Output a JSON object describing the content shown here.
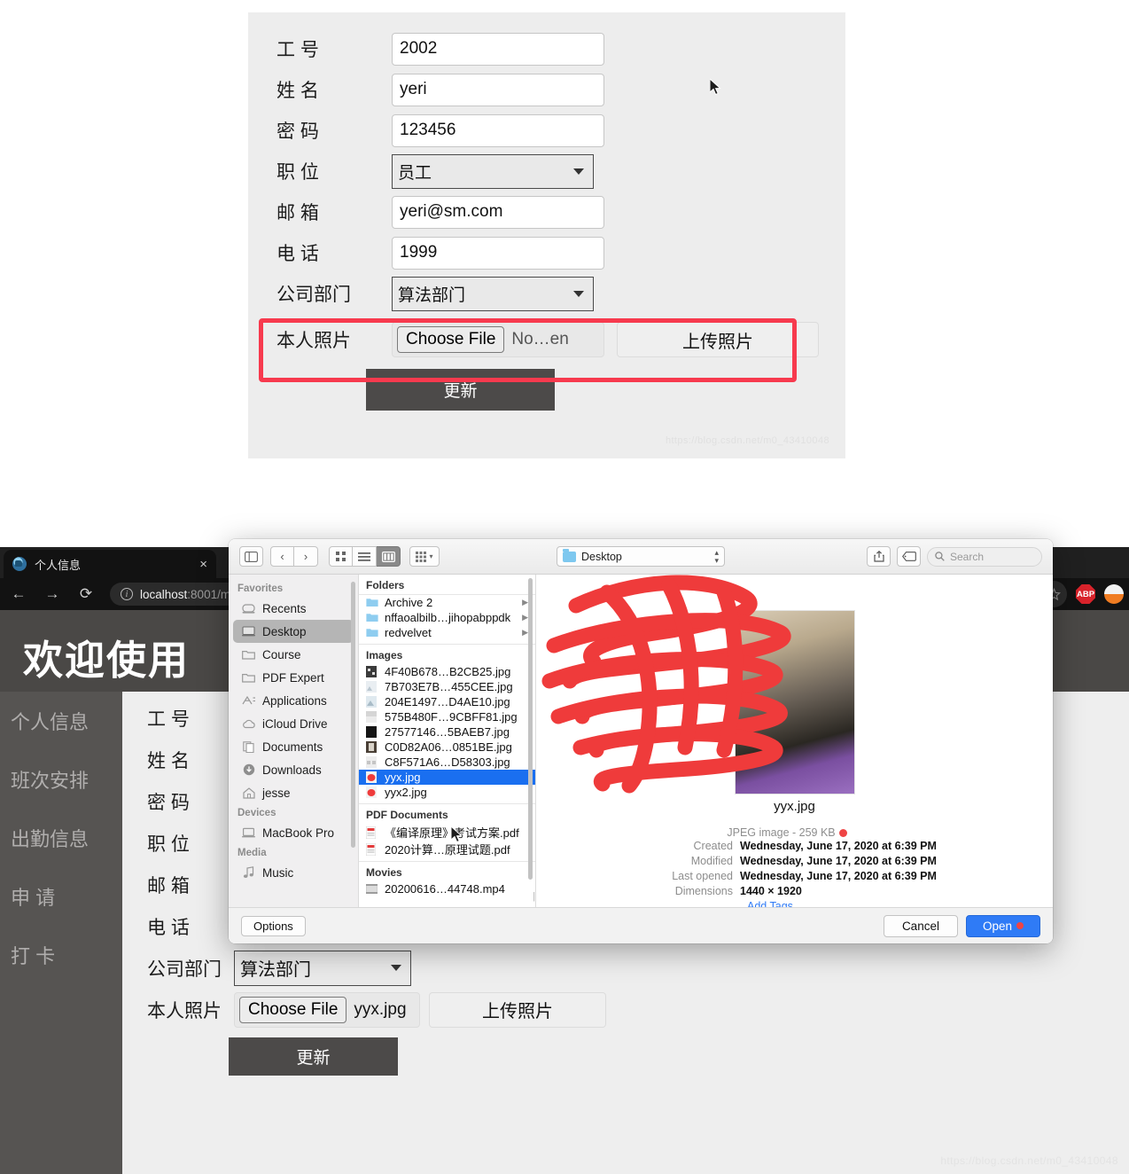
{
  "top_form": {
    "rows": [
      {
        "label": "工 号",
        "value": "2002",
        "type": "text"
      },
      {
        "label": "姓 名",
        "value": "yeri",
        "type": "text"
      },
      {
        "label": "密 码",
        "value": "123456",
        "type": "text"
      },
      {
        "label": "职 位",
        "value": "员工",
        "type": "select"
      },
      {
        "label": "邮 箱",
        "value": "yeri@sm.com",
        "type": "text"
      },
      {
        "label": "电 话",
        "value": "1999",
        "type": "text"
      },
      {
        "label": "公司部门",
        "value": "算法部门",
        "type": "select"
      }
    ],
    "photo_label": "本人照片",
    "choose_file_label": "Choose File",
    "file_name": "No…en",
    "upload_label": "上传照片",
    "submit_label": "更新",
    "watermark": "https://blog.csdn.net/m0_43410048"
  },
  "browser": {
    "tab_title": "个人信息",
    "close_label": "×",
    "back_icon": "←",
    "forward_icon": "→",
    "reload_icon": "⟳",
    "url_host": "localhost",
    "url_rest": ":8001/m",
    "star_icon": "☆",
    "abp_label": "ABP"
  },
  "page": {
    "header_title": "欢迎使用",
    "sidebar_items": [
      {
        "label": "个人信息"
      },
      {
        "label": "班次安排"
      },
      {
        "label": "出勤信息"
      },
      {
        "label": "申 请"
      },
      {
        "label": "打 卡"
      }
    ],
    "form_rows": [
      {
        "label": "工 号"
      },
      {
        "label": "姓 名"
      },
      {
        "label": "密 码"
      },
      {
        "label": "职 位"
      },
      {
        "label": "邮 箱"
      },
      {
        "label": "电 话"
      }
    ],
    "dept_label": "公司部门",
    "dept_value": "算法部门",
    "photo_label": "本人照片",
    "choose_file_label": "Choose File",
    "file_name": "yyx.jpg",
    "upload_label": "上传照片",
    "submit_label": "更新",
    "watermark": "https://blog.csdn.net/m0_43410048"
  },
  "finder": {
    "path_label": "Desktop",
    "search_placeholder": "Search",
    "sidebar": [
      {
        "group": "Favorites",
        "items": [
          {
            "label": "Recents",
            "icon": "clock-icon",
            "selected": false
          },
          {
            "label": "Desktop",
            "icon": "desktop-icon",
            "selected": true
          },
          {
            "label": "Course",
            "icon": "folder-icon",
            "selected": false
          },
          {
            "label": "PDF Expert",
            "icon": "folder-icon",
            "selected": false
          },
          {
            "label": "Applications",
            "icon": "applications-icon",
            "selected": false
          },
          {
            "label": "iCloud Drive",
            "icon": "cloud-icon",
            "selected": false
          },
          {
            "label": "Documents",
            "icon": "documents-icon",
            "selected": false
          },
          {
            "label": "Downloads",
            "icon": "download-icon",
            "selected": false
          },
          {
            "label": "jesse",
            "icon": "home-icon",
            "selected": false
          }
        ]
      },
      {
        "group": "Devices",
        "items": [
          {
            "label": "MacBook Pro",
            "icon": "laptop-icon",
            "selected": false
          }
        ]
      },
      {
        "group": "Media",
        "items": [
          {
            "label": "Music",
            "icon": "music-icon",
            "selected": false
          }
        ]
      }
    ],
    "columns": [
      {
        "group": "Folders",
        "items": [
          {
            "label": "Archive 2",
            "kind": "folder",
            "selected": false
          },
          {
            "label": "nffaoalbilb…jihopabppdk",
            "kind": "folder",
            "selected": false
          },
          {
            "label": "redvelvet",
            "kind": "folder",
            "selected": false
          }
        ]
      },
      {
        "group": "Images",
        "items": [
          {
            "label": "4F40B678…B2CB25.jpg",
            "kind": "image",
            "selected": false
          },
          {
            "label": "7B703E7B…455CEE.jpg",
            "kind": "image",
            "selected": false
          },
          {
            "label": "204E1497…D4AE10.jpg",
            "kind": "image",
            "selected": false
          },
          {
            "label": "575B480F…9CBFF81.jpg",
            "kind": "image",
            "selected": false
          },
          {
            "label": "27577146…5BAEB7.jpg",
            "kind": "image",
            "selected": false
          },
          {
            "label": "C0D82A06…0851BE.jpg",
            "kind": "image",
            "selected": false
          },
          {
            "label": "C8F571A6…D58303.jpg",
            "kind": "image",
            "selected": false
          },
          {
            "label": "yyx.jpg",
            "kind": "image",
            "selected": true
          },
          {
            "label": "yyx2.jpg",
            "kind": "image",
            "selected": false
          }
        ]
      },
      {
        "group": "PDF Documents",
        "items": [
          {
            "label": "《编译原理》考试方案.pdf",
            "kind": "pdf",
            "selected": false
          },
          {
            "label": "2020计算…原理试题.pdf",
            "kind": "pdf",
            "selected": false
          }
        ]
      },
      {
        "group": "Movies",
        "items": [
          {
            "label": "20200616…44748.mp4",
            "kind": "movie",
            "selected": false
          }
        ]
      }
    ],
    "preview": {
      "name": "yyx.jpg",
      "kind": "JPEG image - 259 KB",
      "fields": [
        {
          "key": "Created",
          "value": "Wednesday, June 17, 2020 at 6:39 PM"
        },
        {
          "key": "Modified",
          "value": "Wednesday, June 17, 2020 at 6:39 PM"
        },
        {
          "key": "Last opened",
          "value": "Wednesday, June 17, 2020 at 6:39 PM"
        },
        {
          "key": "Dimensions",
          "value": "1440 × 1920"
        }
      ],
      "add_tags": "Add Tags…"
    },
    "options_label": "Options",
    "cancel_label": "Cancel",
    "open_label": "Open"
  },
  "colors": {
    "accent_blue": "#2f7bf6",
    "selection_blue": "#1a6ff0",
    "highlight_red": "#f73a4e",
    "tag_red": "#ef4444",
    "sidebar_gray": "#565452",
    "header_gray": "#4a4846"
  }
}
